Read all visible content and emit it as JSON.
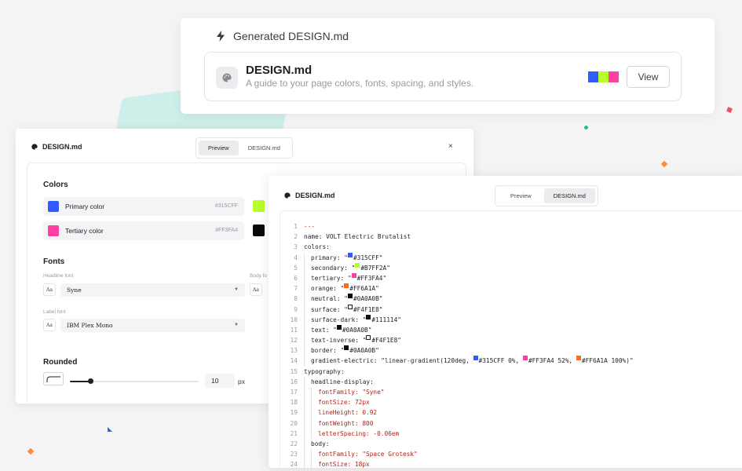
{
  "generated": {
    "header": "Generated DESIGN.md",
    "file_title": "DESIGN.md",
    "file_subtitle": "A guide to your page colors, fonts, spacing, and styles.",
    "swatch_colors": [
      "#315CFF",
      "#B7FF2A",
      "#FF3FA4"
    ],
    "view_label": "View"
  },
  "preview_panel": {
    "title": "DESIGN.md",
    "tabs": [
      "Preview",
      "DESIGN.md"
    ],
    "active_tab": "Preview",
    "close_label": "×",
    "colors_heading": "Colors",
    "colors": [
      {
        "name": "Primary color",
        "hex": "#315CFF"
      },
      {
        "name": "Tertiary color",
        "hex": "#FF3FA4"
      }
    ],
    "peek_swatches": [
      "#B7FF2A",
      "#0A0A0B"
    ],
    "fonts_heading": "Fonts",
    "headline_label": "Headline font",
    "headline_value": "Syne",
    "body_label": "Body fo",
    "label_label": "Label font",
    "label_value": "IBM Plex Mono",
    "aa_label": "Aa",
    "rounded_heading": "Rounded",
    "rounded_value": "10",
    "rounded_unit": "px",
    "rounded_slider_fraction": 0.16
  },
  "code_panel": {
    "title": "DESIGN.md",
    "tabs": [
      "Preview",
      "DESIGN.md"
    ],
    "active_tab": "DESIGN.md",
    "lines": [
      {
        "n": "1",
        "indent": 0,
        "type": "dash",
        "text": "---"
      },
      {
        "n": "2",
        "indent": 0,
        "type": "plain",
        "text": "name: VOLT Electric Brutalist"
      },
      {
        "n": "3",
        "indent": 0,
        "type": "plain",
        "text": "colors:"
      },
      {
        "n": "4",
        "indent": 1,
        "type": "color",
        "key": "primary: \"",
        "swatch": "#315CFF",
        "text": "#315CFF\""
      },
      {
        "n": "5",
        "indent": 1,
        "type": "color",
        "key": "secondary: \"",
        "swatch": "#B7FF2A",
        "text": "#B7FF2A\""
      },
      {
        "n": "6",
        "indent": 1,
        "type": "color",
        "key": "tertiary: \"",
        "swatch": "#FF3FA4",
        "text": "#FF3FA4\""
      },
      {
        "n": "7",
        "indent": 1,
        "type": "color",
        "key": "orange: \"",
        "swatch": "#FF6A1A",
        "text": "#FF6A1A\""
      },
      {
        "n": "8",
        "indent": 1,
        "type": "color",
        "key": "neutral: \"",
        "swatch": "#0A0A0B",
        "text": "#0A0A0B\""
      },
      {
        "n": "9",
        "indent": 1,
        "type": "color",
        "key": "surface: \"",
        "swatch": "#F4F1E8",
        "outline": true,
        "text": "#F4F1E8\""
      },
      {
        "n": "10",
        "indent": 1,
        "type": "color",
        "key": "surface-dark: \"",
        "swatch": "#111114",
        "text": "#111114\""
      },
      {
        "n": "11",
        "indent": 1,
        "type": "color",
        "key": "text: \"",
        "swatch": "#0A0A0B",
        "text": "#0A0A0B\""
      },
      {
        "n": "12",
        "indent": 1,
        "type": "color",
        "key": "text-inverse: \"",
        "swatch": "#F4F1E8",
        "outline": true,
        "text": "#F4F1E8\""
      },
      {
        "n": "13",
        "indent": 1,
        "type": "color",
        "key": "border: \"",
        "swatch": "#0A0A0B",
        "text": "#0A0A0B\""
      },
      {
        "n": "14",
        "indent": 1,
        "type": "gradient",
        "key": "gradient-electric: \"linear-gradient(120deg, ",
        "stops": [
          {
            "swatch": "#315CFF",
            "text": "#315CFF 0%, "
          },
          {
            "swatch": "#FF3FA4",
            "text": "#FF3FA4 52%, "
          },
          {
            "swatch": "#FF6A1A",
            "text": "#FF6A1A 100%)\""
          }
        ]
      },
      {
        "n": "15",
        "indent": 0,
        "type": "plain",
        "text": "typography:"
      },
      {
        "n": "16",
        "indent": 1,
        "type": "plain",
        "text": "headline-display:"
      },
      {
        "n": "17",
        "indent": 2,
        "type": "red",
        "text": "fontFamily: \"Syne\""
      },
      {
        "n": "18",
        "indent": 2,
        "type": "red",
        "text": "fontSize: 72px"
      },
      {
        "n": "19",
        "indent": 2,
        "type": "red",
        "text": "lineHeight: 0.92"
      },
      {
        "n": "20",
        "indent": 2,
        "type": "red",
        "text": "fontWeight: 800"
      },
      {
        "n": "21",
        "indent": 2,
        "type": "red",
        "text": "letterSpacing: -0.06em"
      },
      {
        "n": "22",
        "indent": 1,
        "type": "plain",
        "text": "body:"
      },
      {
        "n": "23",
        "indent": 2,
        "type": "red",
        "text": "fontFamily: \"Space Grotesk\""
      },
      {
        "n": "24",
        "indent": 2,
        "type": "red",
        "text": "fontSize: 18px"
      }
    ]
  }
}
